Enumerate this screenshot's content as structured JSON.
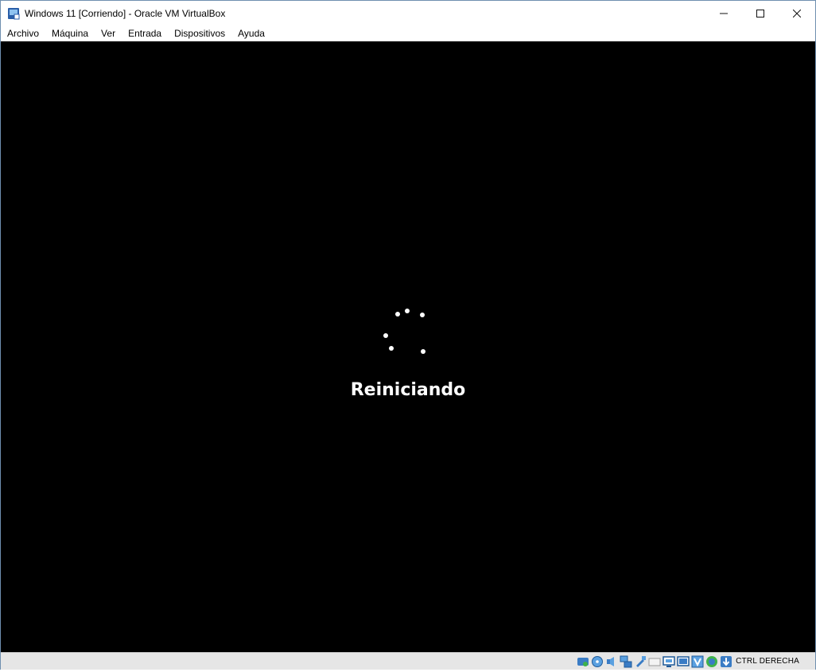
{
  "window": {
    "title": "Windows 11 [Corriendo] - Oracle VM VirtualBox",
    "controls": {
      "minimize": "─",
      "maximize": "☐",
      "close": "✕"
    }
  },
  "menu": {
    "items": [
      "Archivo",
      "Máquina",
      "Ver",
      "Entrada",
      "Dispositivos",
      "Ayuda"
    ]
  },
  "vm": {
    "status_text": "Reiniciando",
    "background": "#000000",
    "spinner_color": "#ffffff"
  },
  "statusbar": {
    "icons": [
      "hard-disk-icon",
      "optical-drive-icon",
      "audio-icon",
      "network-icon",
      "usb-icon",
      "shared-folders-icon",
      "display-icon",
      "video-capture-icon",
      "vt-x-icon",
      "mouse-integration-icon",
      "keyboard-icon"
    ],
    "host_key": "CTRL DERECHA"
  }
}
